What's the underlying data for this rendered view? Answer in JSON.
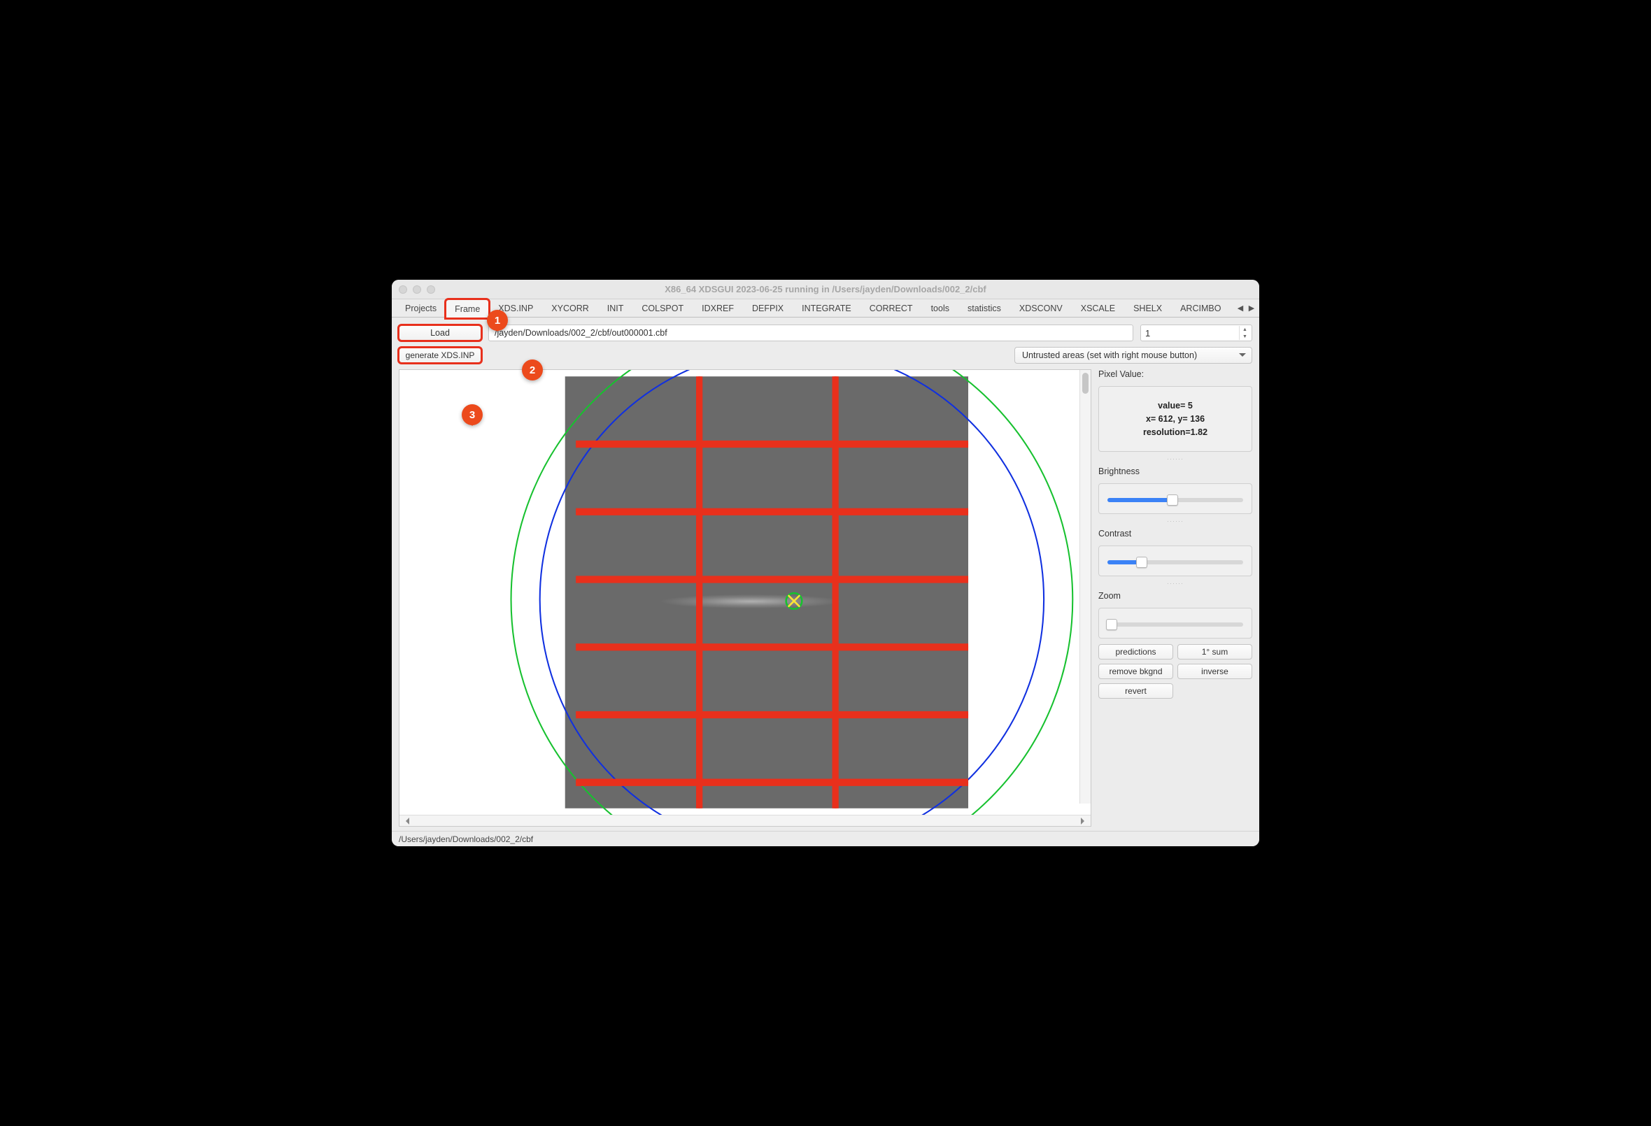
{
  "window": {
    "title": "X86_64 XDSGUI 2023-06-25 running in /Users/jayden/Downloads/002_2/cbf",
    "status_path": "/Users/jayden/Downloads/002_2/cbf"
  },
  "tabs": {
    "items": [
      "Projects",
      "Frame",
      "XDS.INP",
      "XYCORR",
      "INIT",
      "COLSPOT",
      "IDXREF",
      "DEFPIX",
      "INTEGRATE",
      "CORRECT",
      "tools",
      "statistics",
      "XDSCONV",
      "XSCALE",
      "SHELX",
      "ARCIMBO"
    ],
    "active_index": 1
  },
  "toolbar": {
    "load_label": "Load",
    "path_value": "/jayden/Downloads/002_2/cbf/out000001.cbf",
    "frame_number": "1",
    "generate_label": "generate XDS.INP",
    "untrusted_combo": "Untrusted areas (set with right mouse button)"
  },
  "markers": {
    "m1": "1",
    "m2": "2",
    "m3": "3"
  },
  "side": {
    "pixel_label": "Pixel Value:",
    "pixel_value": "value= 5",
    "pixel_xy": "x= 612, y= 136",
    "pixel_res": "resolution=1.82",
    "brightness_label": "Brightness",
    "brightness_pct": 48,
    "contrast_label": "Contrast",
    "contrast_pct": 25,
    "zoom_label": "Zoom",
    "zoom_pct": 3,
    "btn_predictions": "predictions",
    "btn_1degsum": "1° sum",
    "btn_remove_bkgnd": "remove bkgnd",
    "btn_inverse": "inverse",
    "btn_revert": "revert"
  },
  "colors": {
    "marker": "#ec4a1c",
    "redline": "#e8301c",
    "green": "#17c12f",
    "blue": "#1030e0"
  }
}
